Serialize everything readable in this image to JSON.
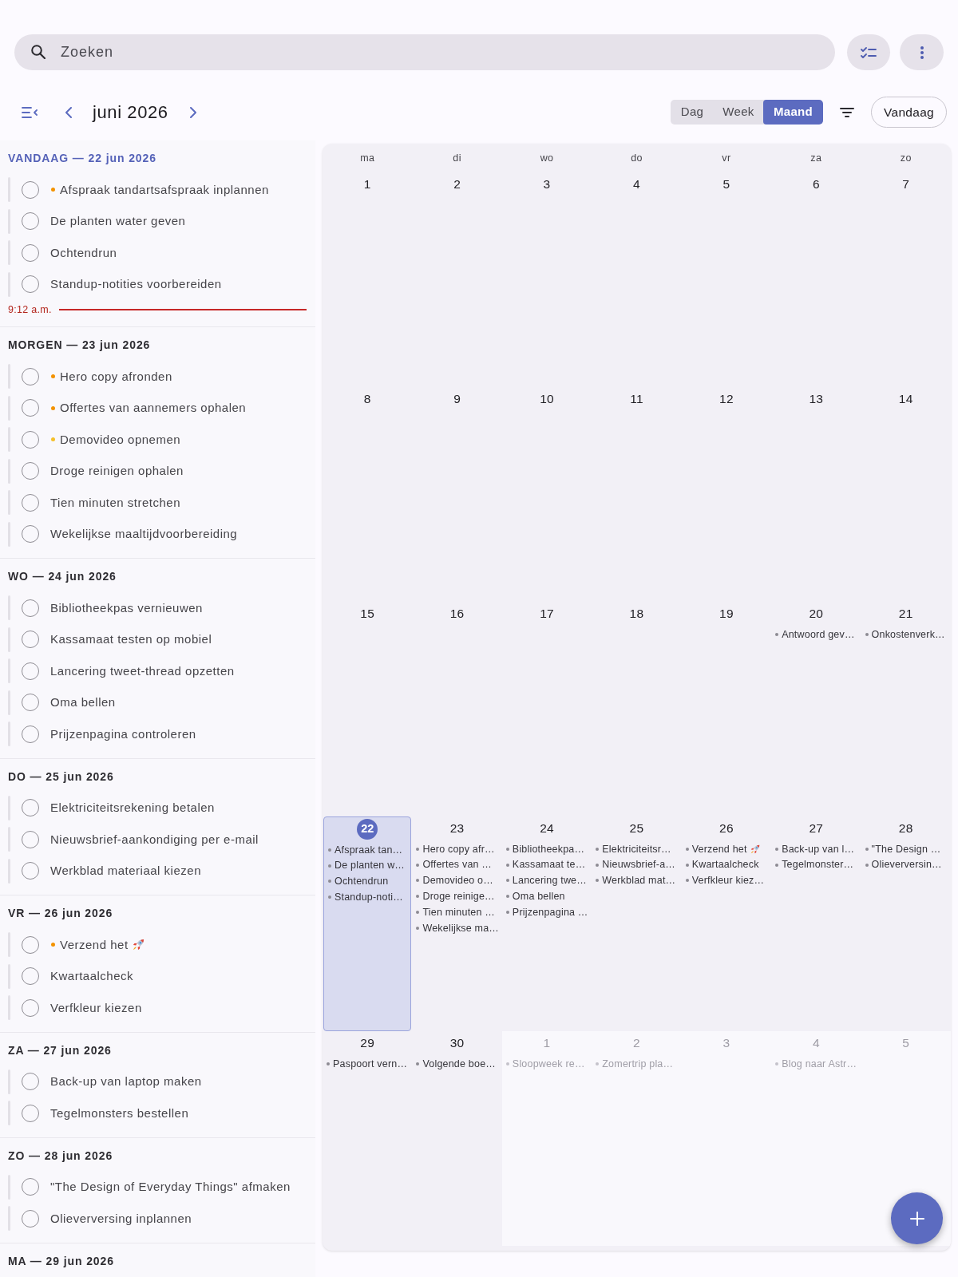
{
  "search": {
    "placeholder": "Zoeken"
  },
  "toolbar": {
    "title": "juni 2026",
    "views": [
      {
        "label": "Dag",
        "selected": false
      },
      {
        "label": "Week",
        "selected": false
      },
      {
        "label": "Maand",
        "selected": true
      }
    ],
    "today_button": "Vandaag"
  },
  "agenda": {
    "sections": [
      {
        "title": "VANDAAG — 22 jun 2026",
        "today": true,
        "tasks": [
          {
            "label": "Afspraak tandartsafspraak inplannen",
            "checked": false,
            "color": "#f39200"
          },
          {
            "label": "De planten water geven",
            "checked": false
          },
          {
            "label": "Ochtendrun",
            "checked": false
          },
          {
            "label": "Standup-notities voorbereiden",
            "checked": false
          }
        ],
        "now_marker": "9:12 a.m."
      },
      {
        "title": "MORGEN — 23 jun 2026",
        "today": false,
        "tasks": [
          {
            "label": "Hero copy afronden",
            "checked": false,
            "color": "#f39200"
          },
          {
            "label": "Offertes van aannemers ophalen",
            "checked": false,
            "color": "#f39200"
          },
          {
            "label": "Demovideo opnemen",
            "checked": false,
            "color": "#f5c02a"
          },
          {
            "label": "Droge reinigen ophalen",
            "checked": false
          },
          {
            "label": "Tien minuten stretchen",
            "checked": false
          },
          {
            "label": "Wekelijkse maaltijdvoorbereiding",
            "checked": false
          }
        ]
      },
      {
        "title": "WO — 24 jun 2026",
        "today": false,
        "tasks": [
          {
            "label": "Bibliotheekpas vernieuwen",
            "checked": false
          },
          {
            "label": "Kassamaat testen op mobiel",
            "checked": false
          },
          {
            "label": "Lancering tweet-thread opzetten",
            "checked": false
          },
          {
            "label": "Oma bellen",
            "checked": false
          },
          {
            "label": "Prijzenpagina controleren",
            "checked": false
          }
        ]
      },
      {
        "title": "DO — 25 jun 2026",
        "today": false,
        "tasks": [
          {
            "label": "Elektriciteitsrekening betalen",
            "checked": false
          },
          {
            "label": "Nieuwsbrief-aankondiging per e-mail",
            "checked": false
          },
          {
            "label": "Werkblad materiaal kiezen",
            "checked": false
          }
        ]
      },
      {
        "title": "VR — 26 jun 2026",
        "today": false,
        "tasks": [
          {
            "label": "Verzend het",
            "checked": false,
            "color": "#f39200",
            "trailing_icon": true
          },
          {
            "label": "Kwartaalcheck",
            "checked": false
          },
          {
            "label": "Verfkleur kiezen",
            "checked": false
          }
        ]
      },
      {
        "title": "ZA — 27 jun 2026",
        "today": false,
        "tasks": [
          {
            "label": "Back-up van laptop maken",
            "checked": false
          },
          {
            "label": "Tegelmonsters bestellen",
            "checked": false
          }
        ]
      },
      {
        "title": "ZO — 28 jun 2026",
        "today": false,
        "tasks": [
          {
            "label": "\"The Design of Everyday Things\" afmaken",
            "checked": false
          },
          {
            "label": "Olieverversing inplannen",
            "checked": false
          }
        ]
      },
      {
        "title": "MA — 29 jun 2026",
        "today": false
      }
    ]
  },
  "calendar": {
    "weekdays": [
      "ma",
      "di",
      "wo",
      "do",
      "vr",
      "za",
      "zo"
    ],
    "days": [
      {
        "date": "1",
        "in_month": true,
        "today": false
      },
      {
        "date": "2",
        "in_month": true,
        "today": false
      },
      {
        "date": "3",
        "in_month": true,
        "today": false
      },
      {
        "date": "4",
        "in_month": true,
        "today": false
      },
      {
        "date": "5",
        "in_month": true,
        "today": false
      },
      {
        "date": "6",
        "in_month": true,
        "today": false
      },
      {
        "date": "7",
        "in_month": true,
        "today": false
      },
      {
        "date": "8",
        "in_month": true,
        "today": false
      },
      {
        "date": "9",
        "in_month": true,
        "today": false
      },
      {
        "date": "10",
        "in_month": true,
        "today": false
      },
      {
        "date": "11",
        "in_month": true,
        "today": false
      },
      {
        "date": "12",
        "in_month": true,
        "today": false
      },
      {
        "date": "13",
        "in_month": true,
        "today": false
      },
      {
        "date": "14",
        "in_month": true,
        "today": false
      },
      {
        "date": "15",
        "in_month": true,
        "today": false
      },
      {
        "date": "16",
        "in_month": true,
        "today": false
      },
      {
        "date": "17",
        "in_month": true,
        "today": false
      },
      {
        "date": "18",
        "in_month": true,
        "today": false
      },
      {
        "date": "19",
        "in_month": true,
        "today": false
      },
      {
        "date": "20",
        "in_month": true,
        "today": false,
        "events": [
          {
            "label": "Antwoord gev…"
          }
        ]
      },
      {
        "date": "21",
        "in_month": true,
        "today": false,
        "events": [
          {
            "label": "Onkostenverk…"
          }
        ]
      },
      {
        "date": "22",
        "in_month": true,
        "today": true,
        "events": [
          {
            "label": "Afspraak tan…"
          },
          {
            "label": "De planten w…"
          },
          {
            "label": "Ochtendrun"
          },
          {
            "label": "Standup-noti…"
          }
        ]
      },
      {
        "date": "23",
        "in_month": true,
        "today": false,
        "events": [
          {
            "label": "Hero copy afr…"
          },
          {
            "label": "Offertes van …"
          },
          {
            "label": "Demovideo o…"
          },
          {
            "label": "Droge reinige…"
          },
          {
            "label": "Tien minuten …"
          },
          {
            "label": "Wekelijkse ma…"
          }
        ]
      },
      {
        "date": "24",
        "in_month": true,
        "today": false,
        "events": [
          {
            "label": "Bibliotheekpa…"
          },
          {
            "label": "Kassamaat te…"
          },
          {
            "label": "Lancering twe…"
          },
          {
            "label": "Oma bellen"
          },
          {
            "label": "Prijzenpagina …"
          }
        ]
      },
      {
        "date": "25",
        "in_month": true,
        "today": false,
        "events": [
          {
            "label": "Elektriciteitsr…"
          },
          {
            "label": "Nieuwsbrief-a…"
          },
          {
            "label": "Werkblad mat…"
          }
        ]
      },
      {
        "date": "26",
        "in_month": true,
        "today": false,
        "events": [
          {
            "label": "Verzend het",
            "trailing_icon": true
          },
          {
            "label": "Kwartaalcheck"
          },
          {
            "label": "Verfkleur kiez…"
          }
        ]
      },
      {
        "date": "27",
        "in_month": true,
        "today": false,
        "events": [
          {
            "label": "Back-up van l…"
          },
          {
            "label": "Tegelmonster…"
          }
        ]
      },
      {
        "date": "28",
        "in_month": true,
        "today": false,
        "events": [
          {
            "label": "\"The Design …"
          },
          {
            "label": "Olieverversin…"
          }
        ]
      },
      {
        "date": "29",
        "in_month": true,
        "today": false,
        "events": [
          {
            "label": "Paspoort vern…"
          }
        ]
      },
      {
        "date": "30",
        "in_month": true,
        "today": false,
        "events": [
          {
            "label": "Volgende boe…"
          }
        ]
      },
      {
        "date": "1",
        "in_month": false,
        "today": false,
        "events": [
          {
            "label": "Sloopweek re…"
          }
        ]
      },
      {
        "date": "2",
        "in_month": false,
        "today": false,
        "events": [
          {
            "label": "Zomertrip pla…"
          }
        ]
      },
      {
        "date": "3",
        "in_month": false,
        "today": false
      },
      {
        "date": "4",
        "in_month": false,
        "today": false,
        "events": [
          {
            "label": "Blog naar Astr…"
          }
        ]
      },
      {
        "date": "5",
        "in_month": false,
        "today": false
      }
    ]
  }
}
